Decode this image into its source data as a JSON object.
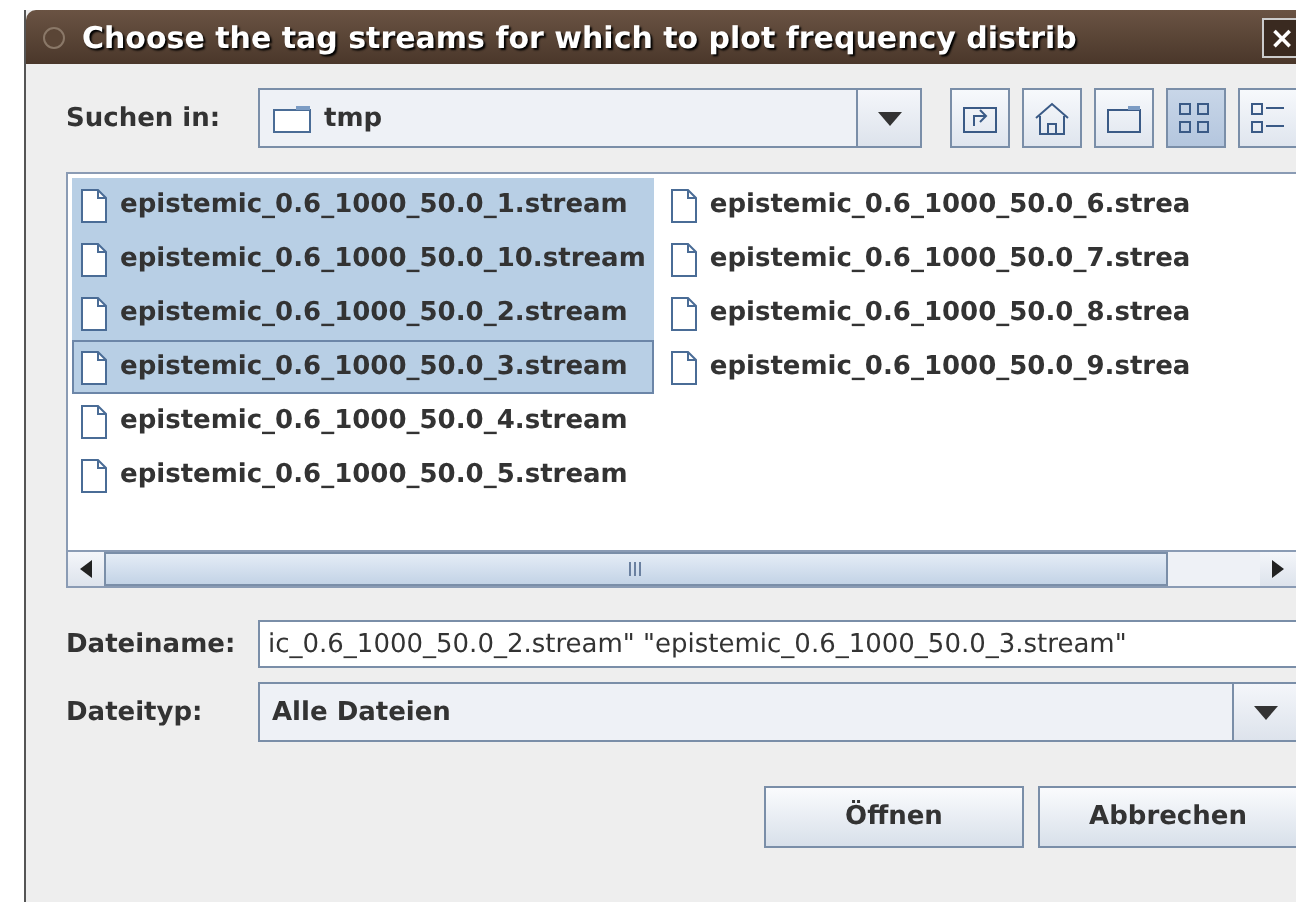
{
  "window": {
    "title": "Choose the tag streams for which to plot frequency distrib",
    "close": "×"
  },
  "look_in": {
    "label": "Suchen in:",
    "value": "tmp"
  },
  "toolbar": [
    {
      "kind": "up",
      "selected": false
    },
    {
      "kind": "home",
      "selected": false
    },
    {
      "kind": "newfolder",
      "selected": false
    },
    {
      "kind": "list",
      "selected": true
    },
    {
      "kind": "details",
      "selected": false
    }
  ],
  "files": [
    {
      "name": "epistemic_0.6_1000_50.0_1.stream",
      "selected": true,
      "focused": false
    },
    {
      "name": "epistemic_0.6_1000_50.0_10.stream",
      "selected": true,
      "focused": false
    },
    {
      "name": "epistemic_0.6_1000_50.0_2.stream",
      "selected": true,
      "focused": false
    },
    {
      "name": "epistemic_0.6_1000_50.0_3.stream",
      "selected": true,
      "focused": true
    },
    {
      "name": "epistemic_0.6_1000_50.0_4.stream",
      "selected": false,
      "focused": false
    },
    {
      "name": "epistemic_0.6_1000_50.0_5.stream",
      "selected": false,
      "focused": false
    },
    {
      "name": "epistemic_0.6_1000_50.0_6.strea",
      "selected": false,
      "focused": false
    },
    {
      "name": "epistemic_0.6_1000_50.0_7.strea",
      "selected": false,
      "focused": false
    },
    {
      "name": "epistemic_0.6_1000_50.0_8.strea",
      "selected": false,
      "focused": false
    },
    {
      "name": "epistemic_0.6_1000_50.0_9.strea",
      "selected": false,
      "focused": false
    }
  ],
  "file_name": {
    "label": "Dateiname:",
    "value": "ic_0.6_1000_50.0_2.stream\" \"epistemic_0.6_1000_50.0_3.stream\""
  },
  "file_type": {
    "label": "Dateityp:",
    "value": "Alle Dateien"
  },
  "buttons": [
    "Öffnen",
    "Abbrechen"
  ]
}
